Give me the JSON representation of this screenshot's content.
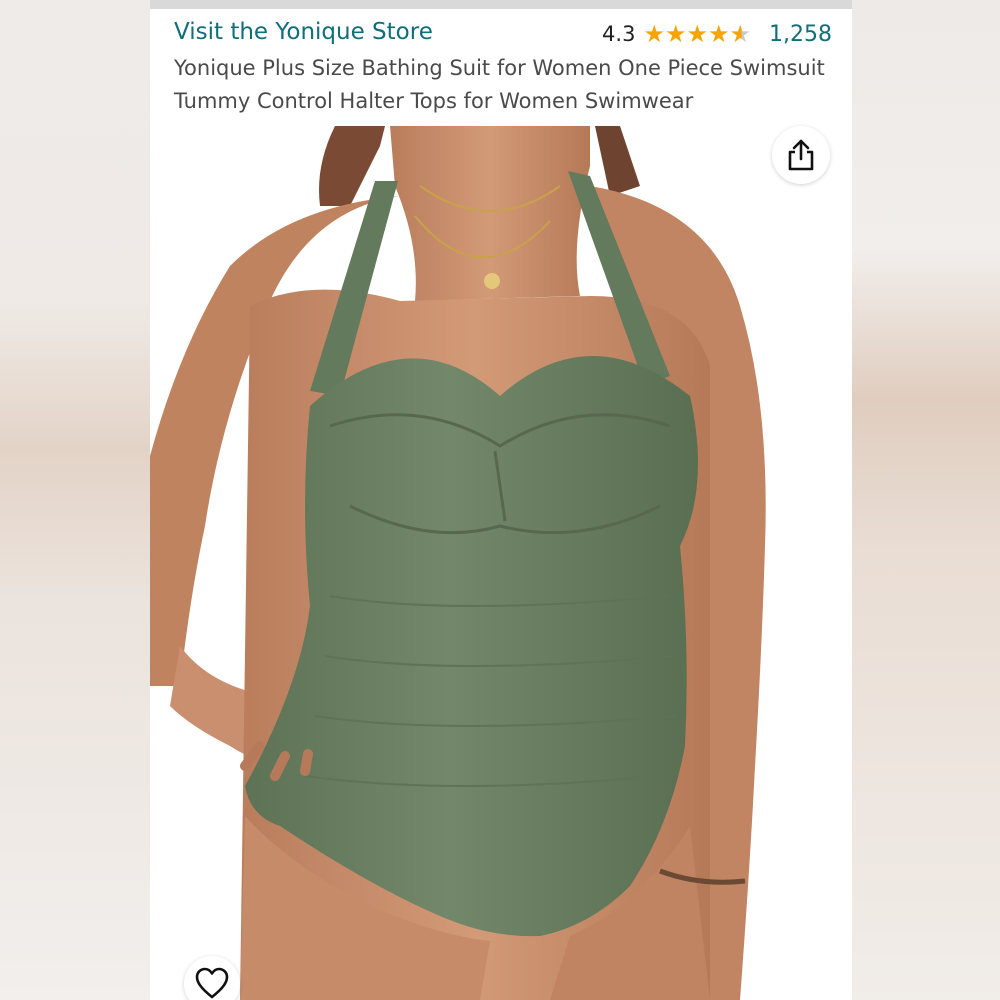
{
  "header": {
    "store_link": "Visit the Yonique Store",
    "rating_value": "4.3",
    "rating_stars": 4.3,
    "rating_count": "1,258",
    "product_title": "Yonique Plus Size Bathing Suit for Women One Piece Swimsuit Tummy Control Halter Tops for Women Swimwear"
  },
  "icons": {
    "share": "share-icon",
    "favorite": "heart-icon",
    "star": "star-icon"
  },
  "colors": {
    "link": "#0f6e78",
    "star": "#f6a500",
    "swimsuit": "#6f8466",
    "skin": "#c98f6e"
  }
}
